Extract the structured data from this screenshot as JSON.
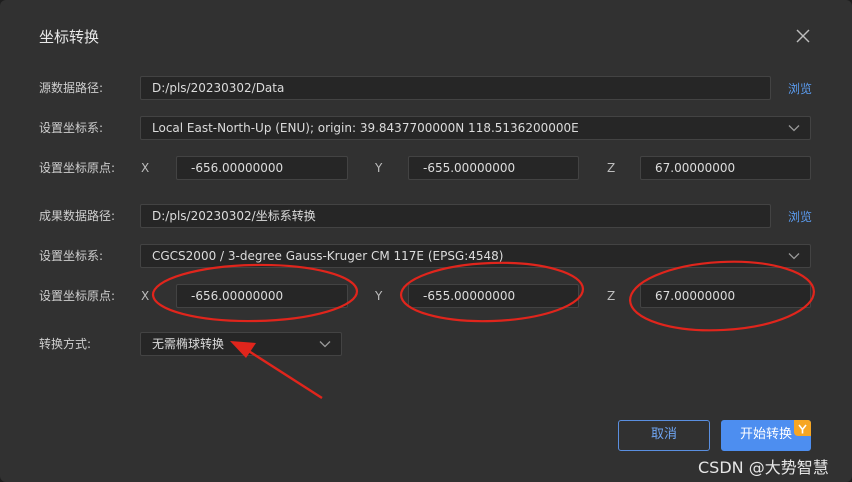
{
  "dialog": {
    "title": "坐标转换"
  },
  "source": {
    "path_label": "源数据路径:",
    "path_value": "D:/pls/20230302/Data",
    "browse_label": "浏览",
    "crs_label": "设置坐标系:",
    "crs_value": "Local East-North-Up (ENU); origin: 39.8437700000N 118.5136200000E",
    "origin_label": "设置坐标原点:",
    "origin": {
      "x_label": "X",
      "x_value": "-656.00000000",
      "y_label": "Y",
      "y_value": "-655.00000000",
      "z_label": "Z",
      "z_value": "67.00000000"
    }
  },
  "result": {
    "path_label": "成果数据路径:",
    "path_value": "D:/pls/20230302/坐标系转换",
    "browse_label": "浏览",
    "crs_label": "设置坐标系:",
    "crs_value": "CGCS2000 / 3-degree Gauss-Kruger CM 117E (EPSG:4548)",
    "origin_label": "设置坐标原点:",
    "origin": {
      "x_label": "X",
      "x_value": "-656.00000000",
      "y_label": "Y",
      "y_value": "-655.00000000",
      "z_label": "Z",
      "z_value": "67.00000000"
    }
  },
  "conversion": {
    "label": "转换方式:",
    "value": "无需椭球转换"
  },
  "buttons": {
    "cancel": "取消",
    "start": "开始转换"
  },
  "watermark": "CSDN @大势智慧",
  "colors": {
    "accent": "#4d8ef0",
    "annotation": "#e0251c",
    "badge": "#f6a623"
  }
}
